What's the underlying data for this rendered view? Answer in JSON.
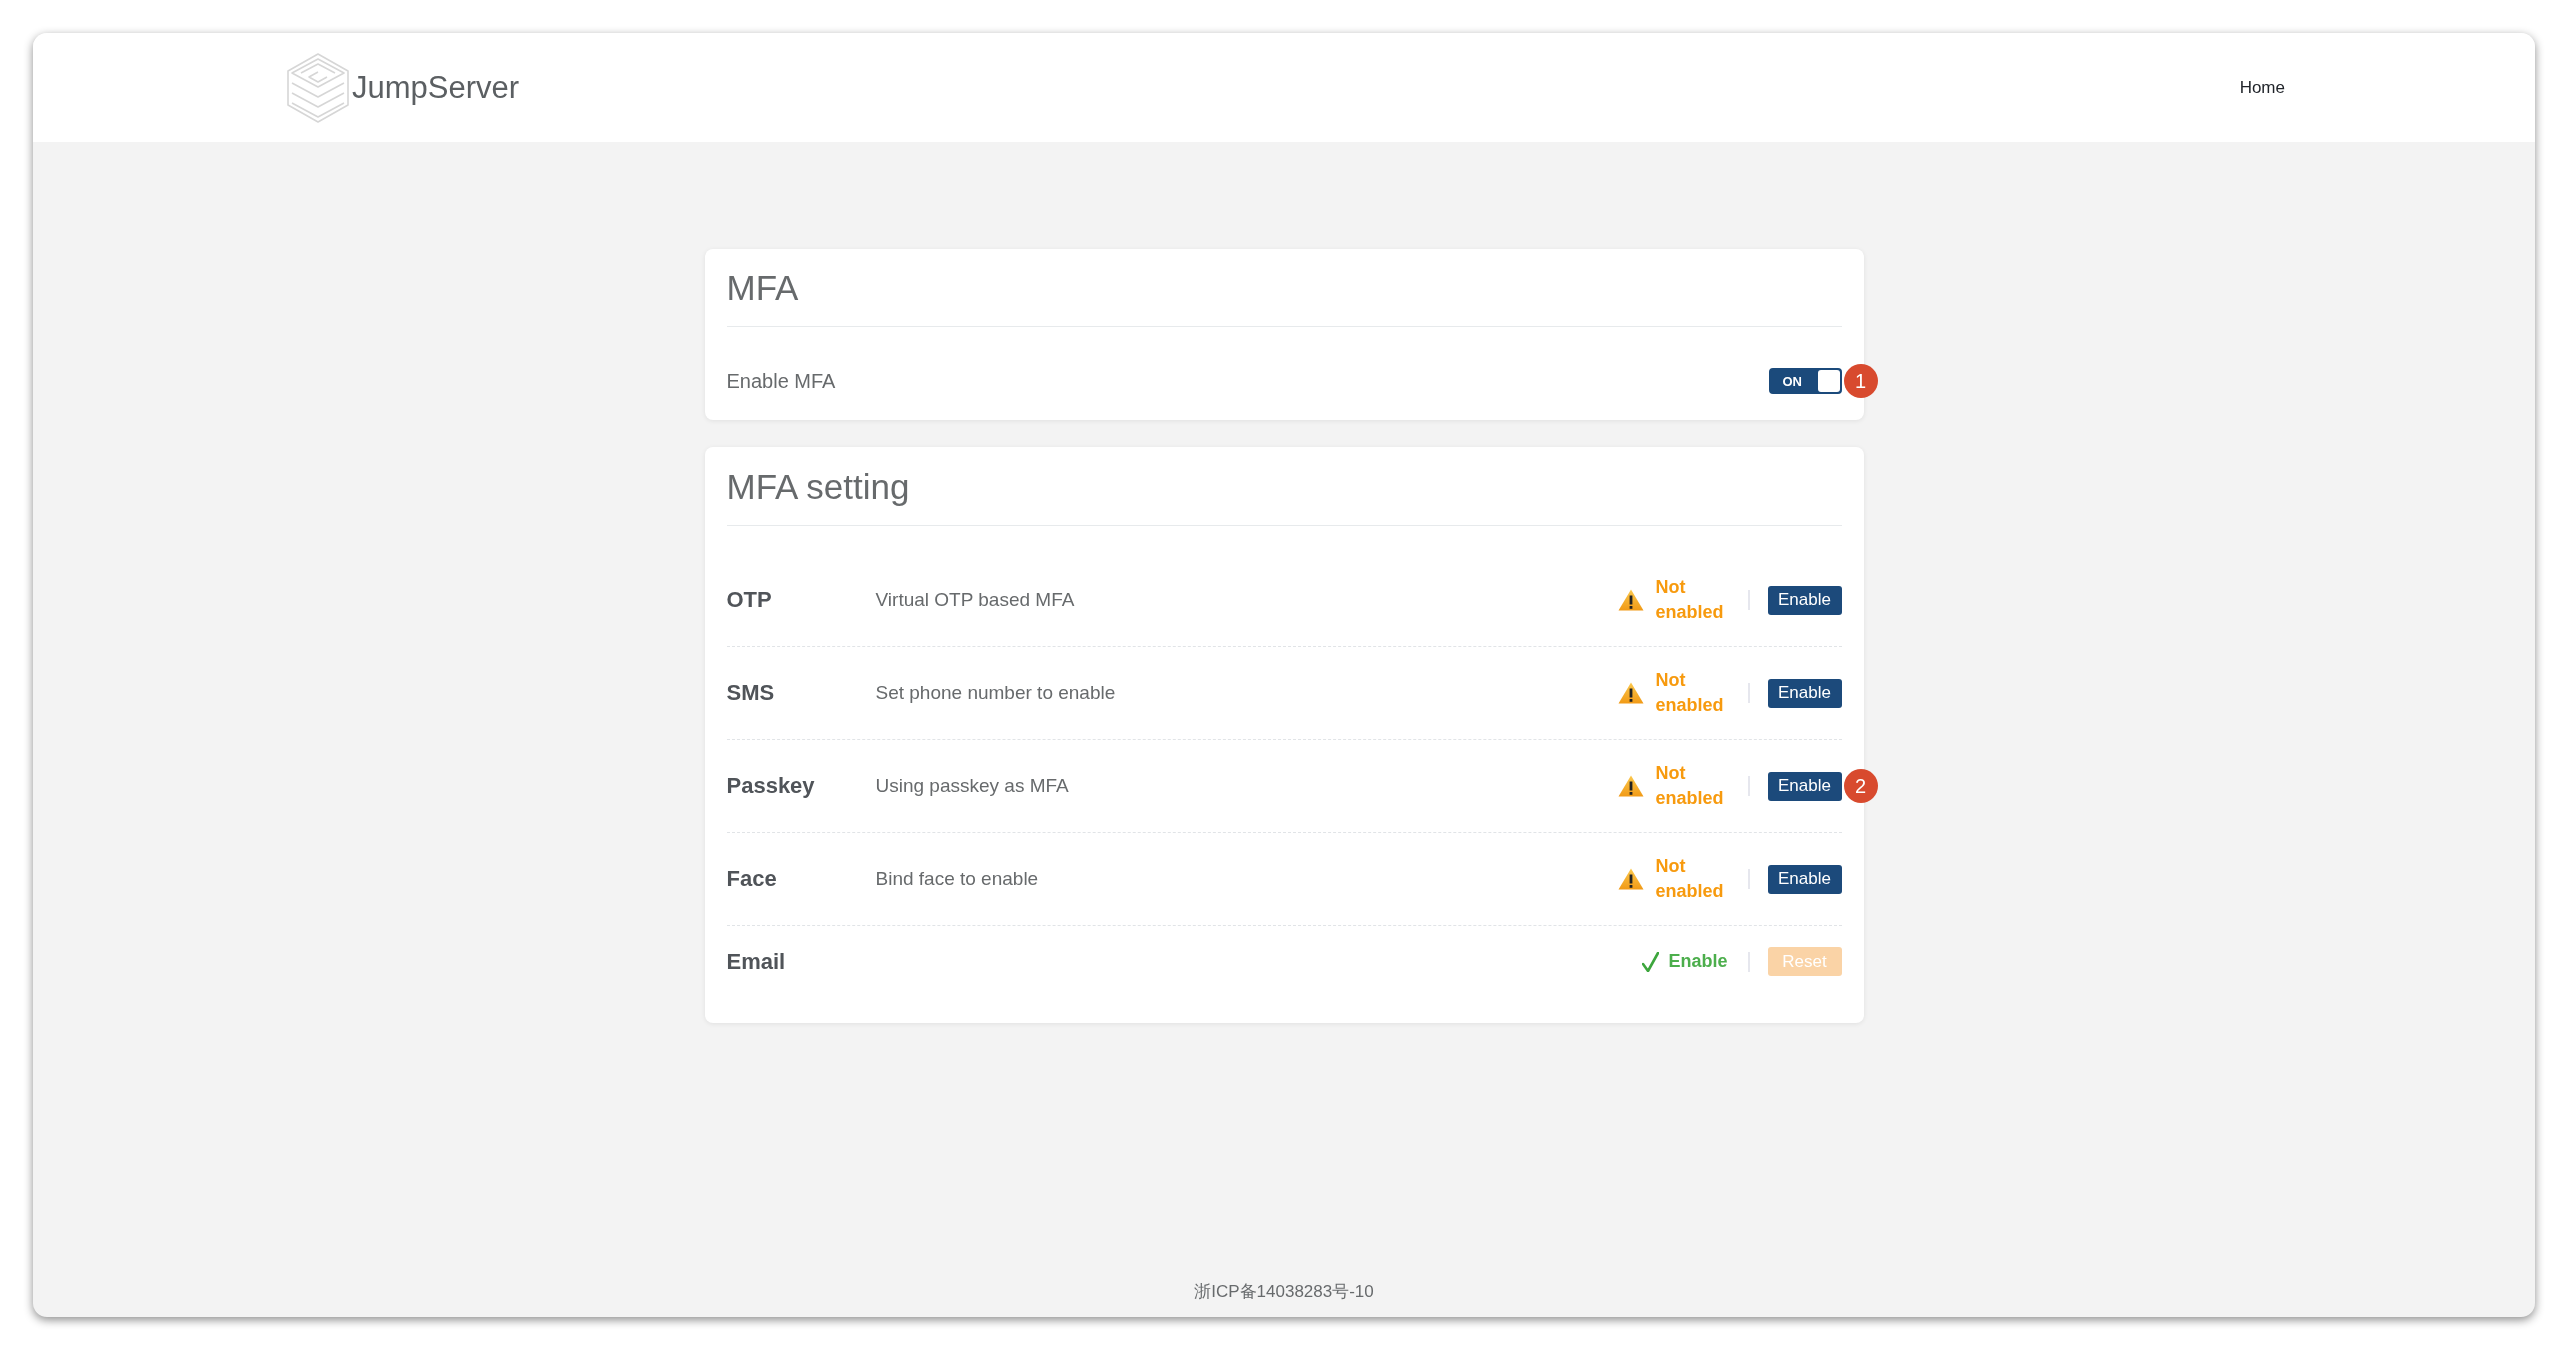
{
  "header": {
    "logo_text": "JumpServer",
    "nav": [
      {
        "label": "Home"
      }
    ]
  },
  "mfa_card": {
    "title": "MFA",
    "setting_label": "Enable MFA",
    "toggle": {
      "label": "ON",
      "on": true,
      "annotation": "1"
    }
  },
  "methods_card": {
    "title": "MFA setting",
    "methods": [
      {
        "name": "OTP",
        "description": "Virtual OTP based MFA",
        "enabled": false,
        "status": "Not enabled",
        "action": {
          "label": "Enable",
          "disabled": false
        }
      },
      {
        "name": "SMS",
        "description": "Set phone number to enable",
        "enabled": false,
        "status": "Not enabled",
        "action": {
          "label": "Enable",
          "disabled": false
        }
      },
      {
        "name": "Passkey",
        "description": "Using passkey as MFA",
        "enabled": false,
        "status": "Not enabled",
        "action": {
          "label": "Enable",
          "disabled": false
        },
        "annotation": "2"
      },
      {
        "name": "Face",
        "description": "Bind face to enable",
        "enabled": false,
        "status": "Not enabled",
        "action": {
          "label": "Enable",
          "disabled": false
        }
      },
      {
        "name": "Email",
        "enabled": true,
        "status": "Enable",
        "action": {
          "label": "Reset",
          "disabled": true
        }
      }
    ]
  },
  "footer": {
    "text": "浙ICP备14038283号-10"
  }
}
